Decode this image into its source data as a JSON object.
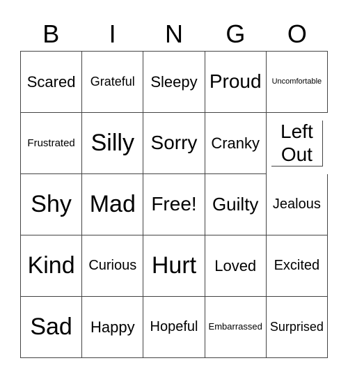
{
  "header": [
    "B",
    "I",
    "N",
    "G",
    "O"
  ],
  "cells": [
    [
      "Scared",
      "Grateful",
      "Sleepy",
      "Proud",
      "Uncomfortable"
    ],
    [
      "Frustrated",
      "Silly",
      "Sorry",
      "Cranky",
      "Left Out"
    ],
    [
      "Shy",
      "Mad",
      "Free!",
      "Guilty",
      "Jealous"
    ],
    [
      "Kind",
      "Curious",
      "Hurt",
      "Loved",
      "Excited"
    ],
    [
      "Sad",
      "Happy",
      "Hopeful",
      "Embarrassed",
      "Surprised"
    ]
  ]
}
